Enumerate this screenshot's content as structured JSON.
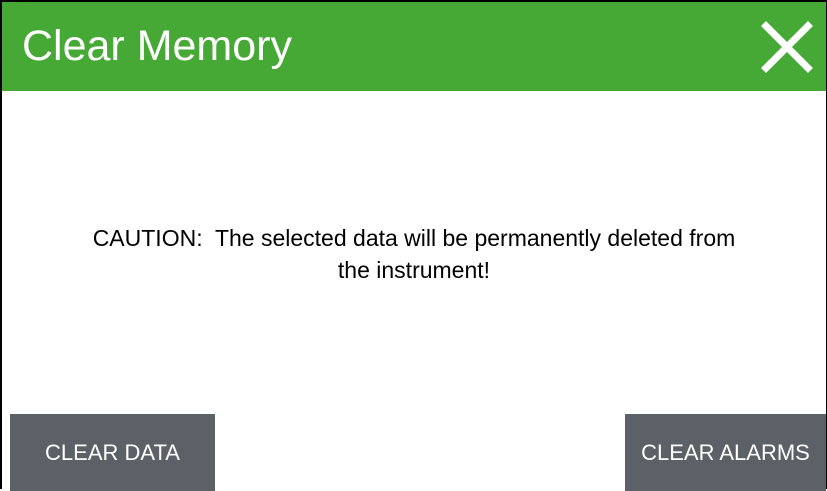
{
  "dialog": {
    "title": "Clear Memory",
    "header_color": "#47a935",
    "close_icon": "close-icon"
  },
  "message": {
    "line1": "CAUTION:  The selected data will be permanently deleted from",
    "line2": "the instrument!"
  },
  "buttons": {
    "clear_data_label": "CLEAR DATA",
    "clear_alarms_label": "CLEAR ALARMS",
    "button_color": "#5b6166"
  }
}
